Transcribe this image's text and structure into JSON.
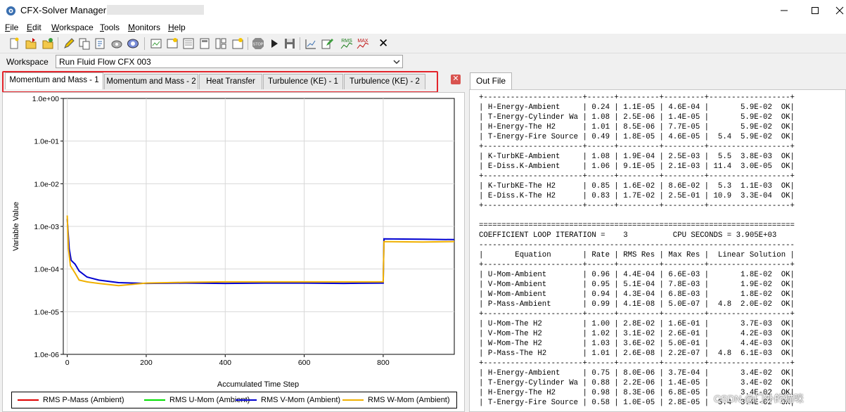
{
  "window": {
    "title": "CFX-Solver Manager",
    "controls": {
      "minimize": "—",
      "maximize": "☐",
      "close": "✕"
    }
  },
  "menu": [
    "File",
    "Edit",
    "Workspace",
    "Tools",
    "Monitors",
    "Help"
  ],
  "toolbar": {
    "icons": [
      "new-icon",
      "open-icon",
      "open-results-icon",
      "edit-icon",
      "copy-icon",
      "define-run-icon",
      "monitor-run-icon",
      "display-icon",
      "view-icon",
      "arrange-icon",
      "layout-icon",
      "workspace-icon",
      "stop-icon",
      "play-icon",
      "save-icon",
      "monitor-edit-icon",
      "monitor-pencil-icon",
      "rms-icon",
      "max-icon",
      "close-icon"
    ],
    "rms_label": "RMS",
    "max_label": "MAX",
    "close_glyph": "✕"
  },
  "workspace": {
    "label": "Workspace",
    "selected": "Run Fluid Flow CFX 003"
  },
  "left_tabs": [
    "Momentum and Mass - 1",
    "Momentum and Mass - 2",
    "Heat Transfer",
    "Turbulence (KE) - 1",
    "Turbulence (KE) - 2"
  ],
  "active_tab": 0,
  "colors": {
    "highlight": "#e3242b",
    "p_mass": "#e00000",
    "u_mom": "#00e000",
    "v_mom": "#0000d0",
    "w_mom": "#f0b000"
  },
  "chart_data": {
    "type": "line",
    "xlabel": "Accumulated Time Step",
    "ylabel": "Variable Value",
    "xlim": [
      -10,
      980
    ],
    "ylim_log10": [
      -6,
      0
    ],
    "y_scale": "log",
    "x_ticks": [
      0,
      200,
      400,
      600,
      800
    ],
    "y_tick_labels": [
      "1.0e+00",
      "1.0e-01",
      "1.0e-02",
      "1.0e-03",
      "1.0e-04",
      "1.0e-05",
      "1.0e-06"
    ],
    "grid": true,
    "legend_placement": "bottom",
    "series": [
      {
        "name": "RMS P-Mass (Ambient)",
        "x": [],
        "y": []
      },
      {
        "name": "RMS U-Mom (Ambient)",
        "x": [],
        "y": []
      },
      {
        "name": "RMS V-Mom (Ambient)",
        "x": [
          0,
          5,
          10,
          20,
          30,
          50,
          80,
          130,
          200,
          300,
          400,
          500,
          600,
          700,
          797,
          800,
          802,
          900,
          980
        ],
        "y": [
          0.0015,
          0.0003,
          0.00016,
          0.00013,
          9e-05,
          6.5e-05,
          5.5e-05,
          4.8e-05,
          4.6e-05,
          4.7e-05,
          4.6e-05,
          4.7e-05,
          4.7e-05,
          4.6e-05,
          4.7e-05,
          4.7e-05,
          0.00051,
          0.0005,
          0.00049
        ]
      },
      {
        "name": "RMS W-Mom (Ambient)",
        "x": [
          0,
          3,
          8,
          20,
          30,
          50,
          80,
          130,
          200,
          300,
          400,
          500,
          600,
          700,
          797,
          800,
          802,
          900,
          980
        ],
        "y": [
          0.0018,
          0.0003,
          0.00012,
          8e-05,
          5.5e-05,
          5e-05,
          4.6e-05,
          4.1e-05,
          4.7e-05,
          4.9e-05,
          5e-05,
          5e-05,
          5e-05,
          5e-05,
          5e-05,
          5e-05,
          0.00044,
          0.00043,
          0.00044
        ]
      }
    ]
  },
  "out_file": {
    "tab_label": "Out File",
    "lines": [
      "+----------------------+------+---------+---------+------------------+",
      "| H-Energy-Ambient     | 0.24 | 1.1E-05 | 4.6E-04 |       5.9E-02  OK|",
      "| T-Energy-Cylinder Wa | 1.08 | 2.5E-06 | 1.4E-05 |       5.9E-02  OK|",
      "| H-Energy-The H2      | 1.01 | 8.5E-06 | 7.7E-05 |       5.9E-02  OK|",
      "| T-Energy-Fire Source | 0.49 | 1.8E-05 | 4.6E-05 |  5.4  5.9E-02  OK|",
      "+----------------------+------+---------+---------+------------------+",
      "| K-TurbKE-Ambient     | 1.08 | 1.9E-04 | 2.5E-03 |  5.5  3.8E-03  OK|",
      "| E-Diss.K-Ambient     | 1.06 | 9.1E-05 | 2.1E-03 | 11.4  3.0E-05  OK|",
      "+----------------------+------+---------+---------+------------------+",
      "| K-TurbKE-The H2      | 0.85 | 1.6E-02 | 8.6E-02 |  5.3  1.1E-03  OK|",
      "| E-Diss.K-The H2      | 0.83 | 1.7E-02 | 2.5E-01 | 10.9  3.3E-04  OK|",
      "+----------------------+------+---------+---------+------------------+",
      "",
      "======================================================================",
      "COEFFICIENT LOOP ITERATION =    3          CPU SECONDS = 3.905E+03",
      "----------------------------------------------------------------------",
      "|       Equation       | Rate | RMS Res | Max Res |  Linear Solution |",
      "+----------------------+------+---------+---------+------------------+",
      "| U-Mom-Ambient        | 0.96 | 4.4E-04 | 6.6E-03 |       1.8E-02  OK|",
      "| V-Mom-Ambient        | 0.95 | 5.1E-04 | 7.8E-03 |       1.9E-02  OK|",
      "| W-Mom-Ambient        | 0.94 | 4.3E-04 | 6.8E-03 |       1.8E-02  OK|",
      "| P-Mass-Ambient       | 0.99 | 4.1E-08 | 5.0E-07 |  4.8  2.0E-02  OK|",
      "+----------------------+------+---------+---------+------------------+",
      "| U-Mom-The H2         | 1.00 | 2.8E-02 | 1.6E-01 |       3.7E-03  OK|",
      "| V-Mom-The H2         | 1.02 | 3.1E-02 | 2.6E-01 |       4.2E-03  OK|",
      "| W-Mom-The H2         | 1.03 | 3.6E-02 | 5.0E-01 |       4.4E-03  OK|",
      "| P-Mass-The H2        | 1.01 | 2.6E-08 | 2.2E-07 |  4.8  6.1E-03  OK|",
      "+----------------------+------+---------+---------+------------------+",
      "| H-Energy-Ambient     | 0.75 | 8.0E-06 | 3.7E-04 |       3.4E-02  OK|",
      "| T-Energy-Cylinder Wa | 0.88 | 2.2E-06 | 1.4E-05 |       3.4E-02  OK|",
      "| H-Energy-The H2      | 0.98 | 8.3E-06 | 6.8E-05 |       3.4E-02  OK|",
      "| T-Energy-Fire Source | 0.58 | 1.0E-05 | 2.8E-05 |  5.4  3.4E-02  OK|"
    ]
  },
  "watermark": "CSDN @门外的猫咪"
}
